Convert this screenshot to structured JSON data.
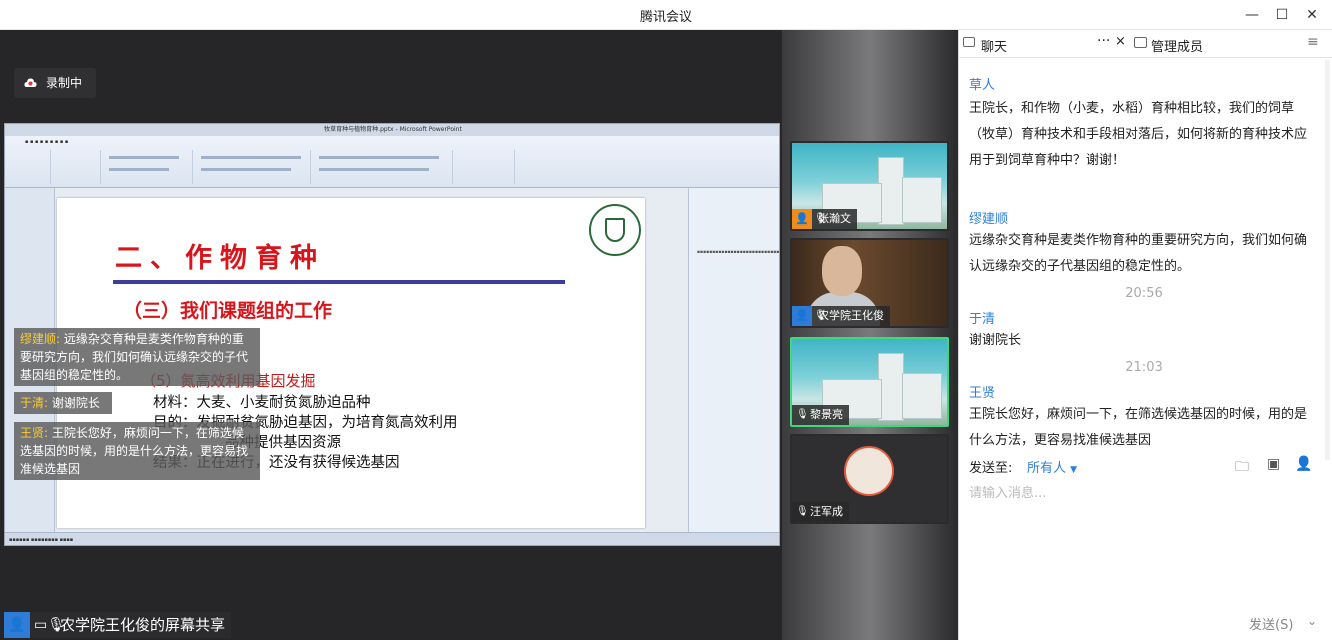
{
  "window": {
    "title": "腾讯会议"
  },
  "stage": {
    "recording_label": "录制中",
    "sharer_label": "农学院王化俊的屏幕共享"
  },
  "ppt": {
    "window_title": "牧草育种与植物育种.pptx - Microsoft PowerPoint",
    "slide": {
      "title": "二、作物育种",
      "subtitle": "（三）我们课题组的工作",
      "item": "（5）氮高效利用基因发掘",
      "lines": [
        "材料：大麦、小麦耐贫氮胁迫品种",
        "目的：发掘耐贫氮胁迫基因，为培育氮高效利用",
        "品种提供基因资源",
        "结果：正在进行，还没有获得候选基因"
      ]
    }
  },
  "captions": [
    {
      "who": "缪建顺:",
      "text": "远缘杂交育种是麦类作物育种的重要研究方向，我们如何确认远缘杂交的子代基因组的稳定性的。"
    },
    {
      "who": "于清:",
      "text": "谢谢院长"
    },
    {
      "who": "王贤:",
      "text": "王院长您好，麻烦问一下，在筛选候选基因的时候，用的是什么方法，更容易找准候选基因"
    }
  ],
  "participants": [
    {
      "name": "张瀚文",
      "avatar": "person-icon",
      "color": "#f08c1e"
    },
    {
      "name": "农学院王化俊",
      "avatar": "person-icon",
      "color": "#2e7bd8"
    },
    {
      "name": "黎景亮",
      "avatar": "",
      "color": ""
    },
    {
      "name": "汪军成",
      "avatar": "",
      "color": ""
    }
  ],
  "panel": {
    "tab_chat": "聊天",
    "tab_more": "···",
    "tab_close": "×",
    "tab_manage": "管理成员",
    "messages": [
      {
        "sender": "草人",
        "text": "王院长，和作物（小麦，水稻）育种相比较，我们的饲草（牧草）育种技术和手段相对落后，如何将新的育种技术应用于到饲草育种中？谢谢！"
      },
      {
        "sender": "缪建顺",
        "text": "远缘杂交育种是麦类作物育种的重要研究方向，我们如何确认远缘杂交的子代基因组的稳定性的。"
      },
      {
        "time": "20:56"
      },
      {
        "sender": "于清",
        "text": "谢谢院长"
      },
      {
        "time": "21:03"
      },
      {
        "sender": "王贤",
        "text": "王院长您好，麻烦问一下，在筛选候选基因的时候，用的是什么方法，更容易找准候选基因"
      }
    ],
    "send_to_label": "发送至:",
    "send_to_value": "所有人",
    "input_placeholder": "请输入消息...",
    "send_button": "发送(S)"
  },
  "colors": {
    "accent": "#2f7fd8",
    "active_speaker": "#3fd87a",
    "slide_title": "#d8151b"
  }
}
